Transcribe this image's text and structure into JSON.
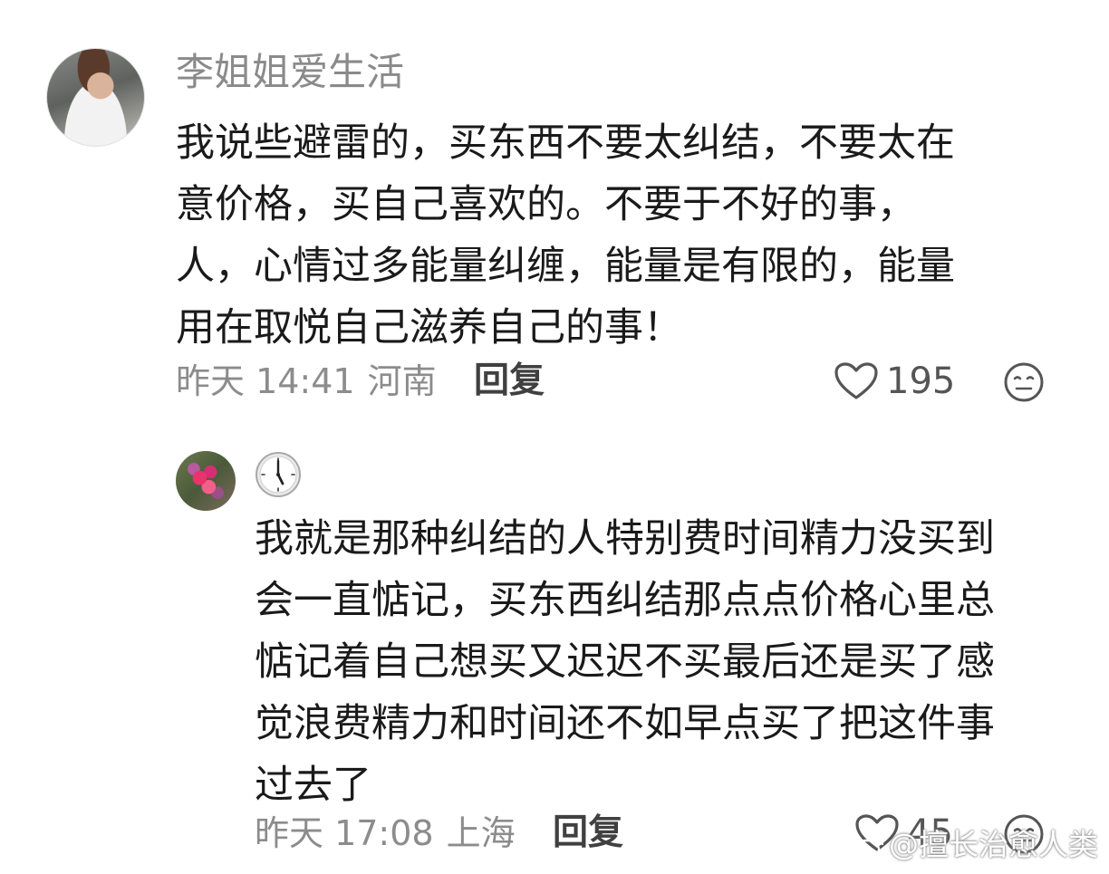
{
  "comment": {
    "username": "李姐姐爱生活",
    "text_lines": [
      "我说些避雷的，买东西不要太纠结，不要太在",
      "意价格，买自己喜欢的。不要于不好的事，",
      "人，心情过多能量纠缠，能量是有限的，能量",
      "用在取悦自己滋养自己的事！"
    ],
    "time": "昨天 14:41",
    "location": "河南",
    "reply_label": "回复",
    "likes": "195"
  },
  "reply": {
    "username_icon": "clock-icon",
    "text_lines": [
      "我就是那种纠结的人特别费时间精力没买到",
      "会一直惦记，买东西纠结那点点价格心里总",
      "惦记着自己想买又迟迟不买最后还是买了感",
      "觉浪费精力和时间还不如早点买了把这件事",
      "过去了"
    ],
    "time": "昨天 17:08",
    "location": "上海",
    "reply_label": "回复",
    "likes": "45"
  },
  "watermark": "@擅长治愈人类",
  "icons": {
    "like": "heart-outline-icon",
    "reaction": "emoji-face-icon"
  },
  "colors": {
    "text": "#1a1a1a",
    "meta": "#8c8c8c",
    "username": "#8a8a8a"
  }
}
